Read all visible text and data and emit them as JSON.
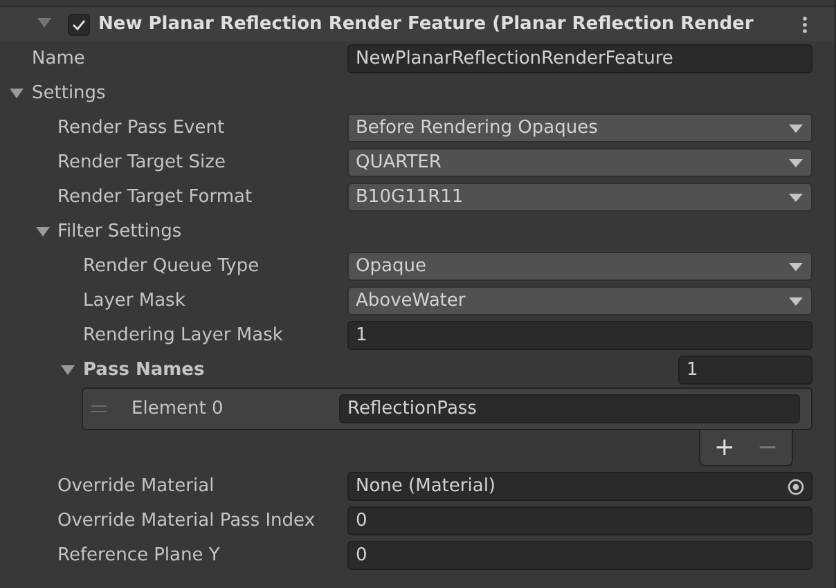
{
  "component": {
    "title": "New Planar Reflection Render Feature (Planar Reflection Render",
    "enabled": true,
    "expanded": true
  },
  "properties": [
    {
      "kind": "text",
      "label": "Name",
      "value": "NewPlanarReflectionRenderFeature"
    },
    {
      "kind": "foldout",
      "label": "Settings",
      "expanded": true,
      "children": [
        {
          "kind": "dropdown",
          "label": "Render Pass Event",
          "value": "Before Rendering Opaques"
        },
        {
          "kind": "dropdown",
          "label": "Render Target Size",
          "value": "QUARTER"
        },
        {
          "kind": "dropdown",
          "label": "Render Target Format",
          "value": "B10G11R11"
        },
        {
          "kind": "foldout",
          "label": "Filter Settings",
          "expanded": true,
          "children": [
            {
              "kind": "dropdown",
              "label": "Render Queue Type",
              "value": "Opaque"
            },
            {
              "kind": "dropdown",
              "label": "Layer Mask",
              "value": "AboveWater"
            },
            {
              "kind": "text",
              "label": "Rendering Layer Mask",
              "value": "1"
            },
            {
              "kind": "list",
              "label": "Pass Names",
              "count": "1",
              "expanded": true,
              "elements": [
                {
                  "label": "Element 0",
                  "value": "ReflectionPass"
                }
              ],
              "add_button": "+",
              "remove_button": "−"
            }
          ]
        },
        {
          "kind": "object",
          "label": "Override Material",
          "value": "None (Material)"
        },
        {
          "kind": "text",
          "label": "Override Material Pass Index",
          "value": "0"
        },
        {
          "kind": "text",
          "label": "Reference Plane Y",
          "value": "0"
        }
      ]
    }
  ]
}
